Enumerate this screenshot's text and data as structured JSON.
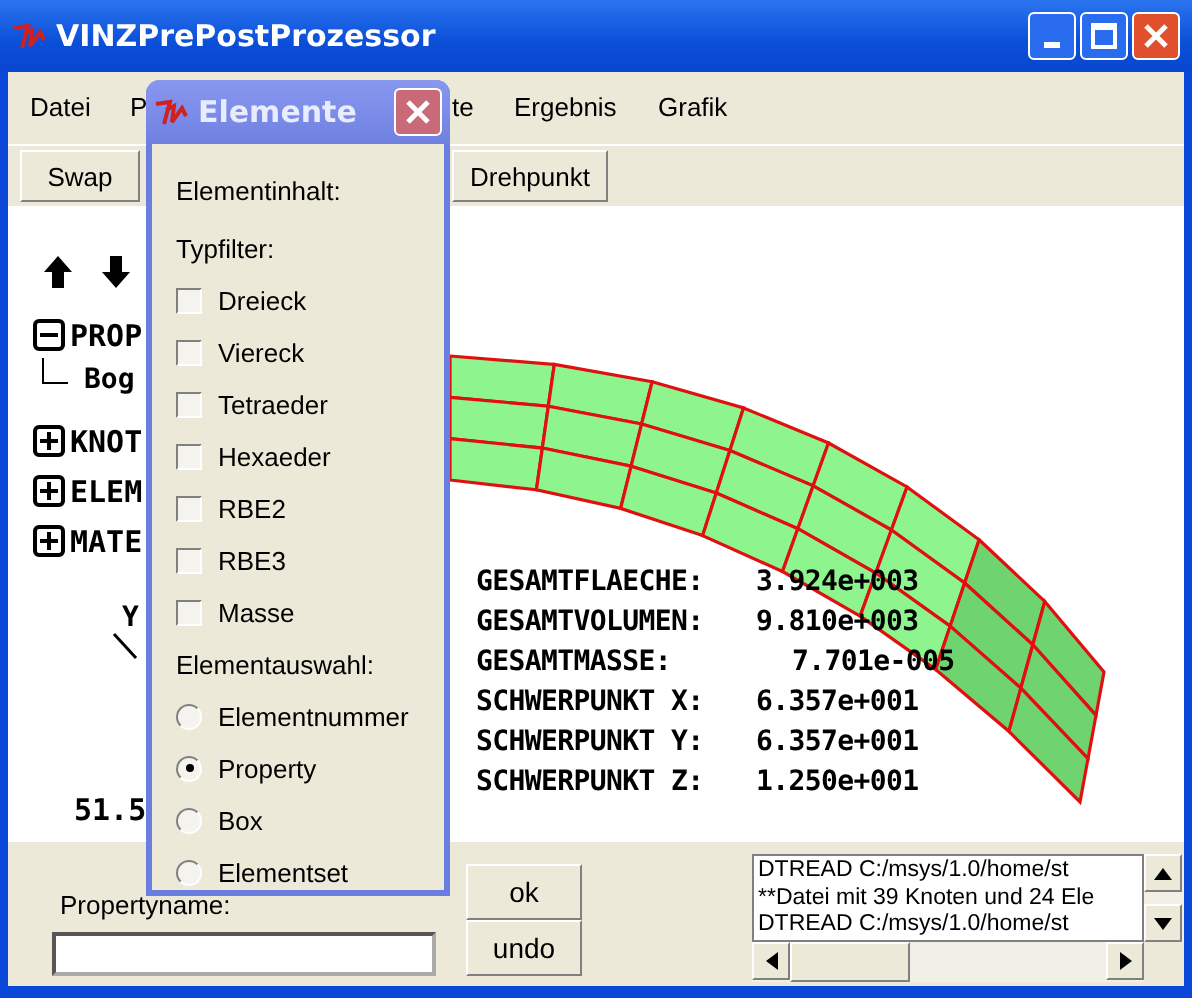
{
  "window": {
    "title": "VINZPrePostProzessor"
  },
  "menu": [
    "Datei",
    "P",
    "te",
    "Ergebnis",
    "Grafik"
  ],
  "toolbar": [
    "Swap",
    "Drehpunkt"
  ],
  "tree": [
    {
      "label": "PROP",
      "expanded": true,
      "children": [
        {
          "label": "Bog"
        }
      ]
    },
    {
      "label": "KNOT",
      "expanded": false
    },
    {
      "label": "ELEM",
      "expanded": false
    },
    {
      "label": "MATE",
      "expanded": false
    }
  ],
  "axis": {
    "label": "Y",
    "value": "51.5"
  },
  "results": [
    {
      "label": "GESAMTFLAECHE:",
      "value": "3.924e+003"
    },
    {
      "label": "GESAMTVOLUMEN:",
      "value": "9.810e+003"
    },
    {
      "label": "GESAMTMASSE:",
      "value": "7.701e-005"
    },
    {
      "label": "SCHWERPUNKT X:",
      "value": "6.357e+001"
    },
    {
      "label": "SCHWERPUNKT Y:",
      "value": "6.357e+001"
    },
    {
      "label": "SCHWERPUNKT Z:",
      "value": "1.250e+001"
    }
  ],
  "bottom": {
    "field_label": "Propertyname:",
    "buttons": [
      "ok",
      "undo"
    ],
    "log": [
      "DTREAD C:/msys/1.0/home/st",
      "**Datei mit 39 Knoten und 24 Ele",
      "DTREAD C:/msys/1.0/home/st"
    ]
  },
  "dialog": {
    "title": "Elemente",
    "content_label": "Elementinhalt:",
    "filter_label": "Typfilter:",
    "filters": [
      {
        "label": "Dreieck",
        "checked": false
      },
      {
        "label": "Viereck",
        "checked": false
      },
      {
        "label": "Tetraeder",
        "checked": false
      },
      {
        "label": "Hexaeder",
        "checked": false
      },
      {
        "label": "RBE2",
        "checked": false
      },
      {
        "label": "RBE3",
        "checked": false
      },
      {
        "label": "Masse",
        "checked": false
      }
    ],
    "selection_label": "Elementauswahl:",
    "options": [
      {
        "label": "Elementnummer",
        "selected": false
      },
      {
        "label": "Property",
        "selected": true
      },
      {
        "label": "Box",
        "selected": false
      },
      {
        "label": "Elementset",
        "selected": false
      }
    ]
  }
}
